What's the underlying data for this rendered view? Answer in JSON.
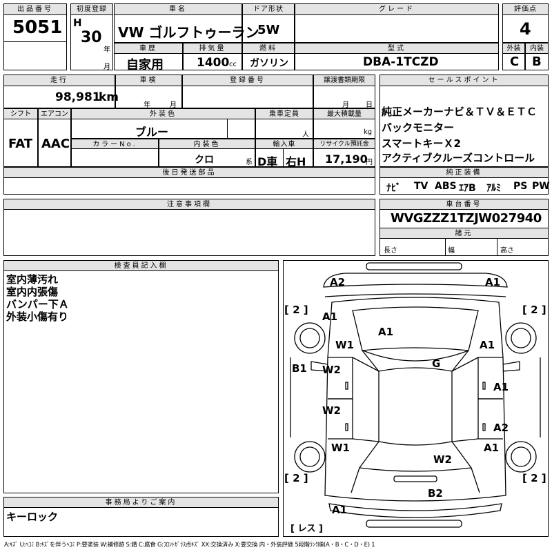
{
  "header": {
    "lot_label": "出品番号",
    "lot_number": "5051",
    "first_reg_label": "初度登録",
    "era": "H",
    "year_value": "30",
    "year_unit": "年",
    "month_unit": "月",
    "car_name_label": "車名",
    "car_name": "VW ゴルフトゥーラン",
    "door_label": "ドア形状",
    "door_value": "5W",
    "grade_label": "グレード",
    "grade_value": "",
    "score_label": "評価点",
    "score_value": "4",
    "history_label": "車歴",
    "history_value": "自家用",
    "displacement_label": "排気量",
    "displacement_value": "1400",
    "displacement_unit": "cc",
    "fuel_label": "燃料",
    "fuel_value": "ガソリン",
    "model_label": "型式",
    "model_value": "DBA-1TCZD",
    "exterior_label": "外装",
    "exterior_value": "C",
    "interior_label": "内装",
    "interior_value": "B"
  },
  "details": {
    "mileage_label": "走行",
    "mileage_value": "98,981",
    "mileage_unit": "km",
    "inspection_label": "車検",
    "inspection_year_unit": "年",
    "inspection_month_unit": "月",
    "reg_number_label": "登録番号",
    "transfer_label": "譲渡書類期限",
    "transfer_month_unit": "月",
    "transfer_day_unit": "日",
    "shift_label": "シフト",
    "shift_value": "FAT",
    "ac_label": "エアコン",
    "ac_value": "AAC",
    "ext_color_label": "外装色",
    "ext_color_value": "ブルー",
    "capacity_label": "乗車定員",
    "capacity_unit": "人",
    "max_load_label": "最大積載量",
    "max_load_unit": "kg",
    "color_no_label": "カラーNo.",
    "int_color_label": "内装色",
    "int_color_value": "クロ",
    "int_color_unit": "系",
    "import_label": "輸入車",
    "import_value": "D車",
    "steering_value": "右H",
    "recycle_label": "リサイクル預託金",
    "recycle_value": "17,190",
    "recycle_unit": "円",
    "later_parts_label": "後日発送部品"
  },
  "sales": {
    "label": "セールスポイント",
    "lines": [
      "純正メーカーナビ＆ＴＶ＆ＥＴＣ",
      "バックモニター",
      "スマートキーＸ2",
      "アクティブクルーズコントロール"
    ],
    "equipment_label": "純正装備",
    "equipment": [
      "ﾅﾋﾞ",
      "TV",
      "ABS",
      "ｴｱB",
      "ｱﾙﾐ",
      "PS",
      "PW"
    ]
  },
  "notes": {
    "caution_label": "注意事項欄",
    "chassis_label": "車台番号",
    "chassis_value": "WVGZZZ1TZJW027940",
    "spec_label": "諸元",
    "length_label": "長さ",
    "width_label": "幅",
    "height_label": "高さ"
  },
  "inspector": {
    "label": "検査員記入欄",
    "lines": [
      "室内薄汚れ",
      "室内内張傷",
      "バンパー下Ａ",
      "外装小傷有り"
    ]
  },
  "office": {
    "label": "事務局よりご案内",
    "text": "キーロック"
  },
  "diagram": {
    "marks": [
      {
        "id": "front-bumper-left",
        "text": "A2"
      },
      {
        "id": "front-bumper-right",
        "text": "A1"
      },
      {
        "id": "fender-front-left",
        "text": "A1"
      },
      {
        "id": "hood",
        "text": "A1"
      },
      {
        "id": "wheel-front-left",
        "text": "W1"
      },
      {
        "id": "fender-front-right",
        "text": "A1"
      },
      {
        "id": "windshield",
        "text": "G"
      },
      {
        "id": "rocker-left",
        "text": "B1"
      },
      {
        "id": "door-front-left",
        "text": "W2"
      },
      {
        "id": "door-front-right",
        "text": "A1"
      },
      {
        "id": "door-rear-left",
        "text": "W2"
      },
      {
        "id": "door-rear-right",
        "text": "A2"
      },
      {
        "id": "wheel-rear-left",
        "text": "W1"
      },
      {
        "id": "fender-rear-right",
        "text": "A1"
      },
      {
        "id": "back-door",
        "text": "W2"
      },
      {
        "id": "rear-bumper",
        "text": "B2"
      },
      {
        "id": "rear-bumper-left",
        "text": "A1"
      }
    ],
    "tires": [
      {
        "id": "tire-front-left",
        "text": "2"
      },
      {
        "id": "tire-front-right",
        "text": "2"
      },
      {
        "id": "tire-rear-left",
        "text": "2"
      },
      {
        "id": "tire-rear-right",
        "text": "2"
      }
    ],
    "spare_label": "レス"
  },
  "legend": "A:ｷｽﾞ U:ﾍｺﾐ B:ｷｽﾞを伴うﾍｺﾐ P:要塗装 W:補修跡 S:錆 C:腐食 G:ﾌﾛﾝﾄｶﾞﾗｽ点ｷｽﾞ XX:交換済み X:要交換 内・外装評価 5段階ﾗﾝｸ順(A・B・C・D・E) 1"
}
